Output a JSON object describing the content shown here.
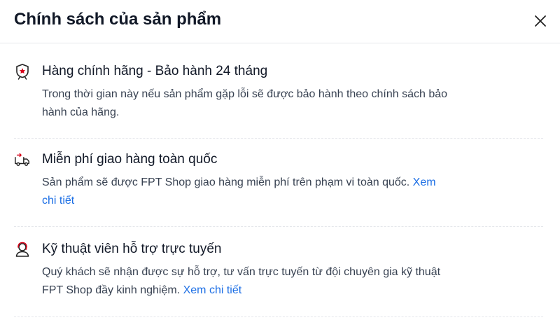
{
  "dialog": {
    "title": "Chính sách của sản phẩm",
    "close_icon": "close-icon"
  },
  "policies": [
    {
      "icon": "badge-star-icon",
      "title": "Hàng chính hãng - Bảo hành 24 tháng",
      "desc_line1": "Trong thời gian này nếu sản phẩm gặp lỗi sẽ được bảo hành theo chính sách bảo",
      "desc_line2": "hành của hãng."
    },
    {
      "icon": "delivery-truck-icon",
      "title": "Miễn phí giao hàng toàn quốc",
      "desc_line1": "Sản phẩm sẽ được FPT Shop giao hàng miễn phí trên phạm vi toàn quốc.",
      "link_part1": "Xem",
      "link_part2": "chi tiết"
    },
    {
      "icon": "support-agent-icon",
      "title": "Kỹ thuật viên hỗ trợ trực tuyến",
      "desc_line1": "Quý khách sẽ nhận được sự hỗ trợ, tư vấn trực tuyến từ đội chuyên gia kỹ thuật",
      "desc_line2": "FPT Shop đầy kinh nghiệm.",
      "link": "Xem chi tiết"
    }
  ],
  "colors": {
    "accent_red": "#d70018",
    "link_blue": "#1d6fe5",
    "text_dark": "#111827"
  }
}
